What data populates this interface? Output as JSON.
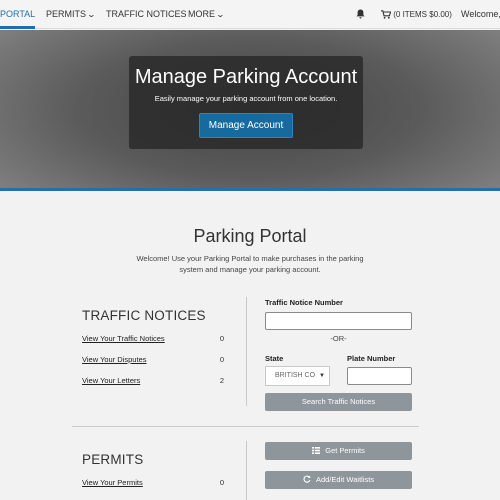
{
  "nav": {
    "portal": "PORTAL",
    "permits": "PERMITS",
    "traffic_notices": "TRAFFIC NOTICES",
    "more": "MORE",
    "cart": "(0 ITEMS $0.00)",
    "welcome": "Welcome, J",
    "icons": {
      "dropdown": "chevron-down-icon",
      "notifications": "bell-icon",
      "cart": "cart-icon"
    }
  },
  "hero": {
    "title": "Manage Parking Account",
    "subtitle": "Easily manage your parking account from one location.",
    "button": "Manage Account"
  },
  "portal": {
    "title": "Parking Portal",
    "intro": "Welcome! Use your Parking Portal to make purchases in the parking system and manage your parking account."
  },
  "traffic_notices": {
    "heading": "TRAFFIC NOTICES",
    "links": [
      {
        "label": "View Your Traffic Notices",
        "count": "0"
      },
      {
        "label": "View Your Disputes",
        "count": "0"
      },
      {
        "label": "View Your Letters",
        "count": "2"
      }
    ],
    "search": {
      "notice_number_label": "Traffic Notice Number",
      "notice_number_value": "",
      "or_text": "-OR-",
      "state_label": "State",
      "state_value": "BRITISH CO",
      "plate_label": "Plate Number",
      "plate_value": "",
      "button": "Search Traffic Notices"
    }
  },
  "permits": {
    "heading": "PERMITS",
    "links": [
      {
        "label": "View Your Permits",
        "count": "0"
      }
    ],
    "get_button": "Get Permits",
    "waitlist_button": "Add/Edit Waitlists"
  },
  "colors": {
    "accent": "#1f6fb0",
    "primary_button": "#166a9e",
    "gray_button": "#8e959b"
  }
}
